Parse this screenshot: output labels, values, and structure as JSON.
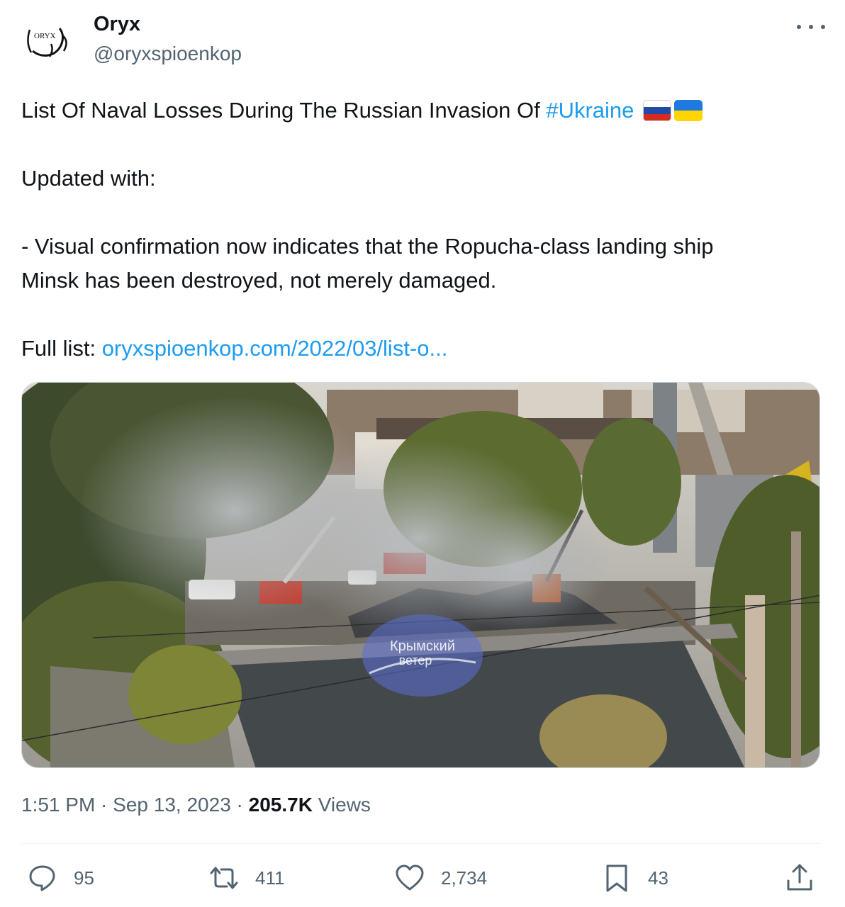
{
  "author": {
    "display_name": "Oryx",
    "handle": "@oryxspioenkop",
    "avatar_logo_text": "ORYX"
  },
  "tweet": {
    "line1": "List Of Naval Losses During The Russian Invasion Of ",
    "hashtag": "#Ukraine",
    "flags": [
      "russia-flag-emoji",
      "ukraine-flag-emoji"
    ],
    "updated_with": "Updated with:",
    "body_line1": "- Visual confirmation now indicates that the Ropucha-class landing ship",
    "body_line2": "Minsk has been destroyed, not merely damaged.",
    "full_list_label": "Full list: ",
    "full_list_link": "oryxspioenkop.com/2022/03/list-o..."
  },
  "media": {
    "watermark_line1": "Крымский",
    "watermark_line2": "ветер"
  },
  "meta": {
    "time": "1:51 PM",
    "sep1": " · ",
    "date": "Sep 13, 2023",
    "sep2": " · ",
    "views_count": "205.7K",
    "views_label": " Views"
  },
  "actions": {
    "replies": "95",
    "reposts": "411",
    "likes": "2,734",
    "bookmarks": "43"
  },
  "colors": {
    "link": "#1d9bf0",
    "secondary_text": "#536471",
    "primary_text": "#0f1419"
  }
}
